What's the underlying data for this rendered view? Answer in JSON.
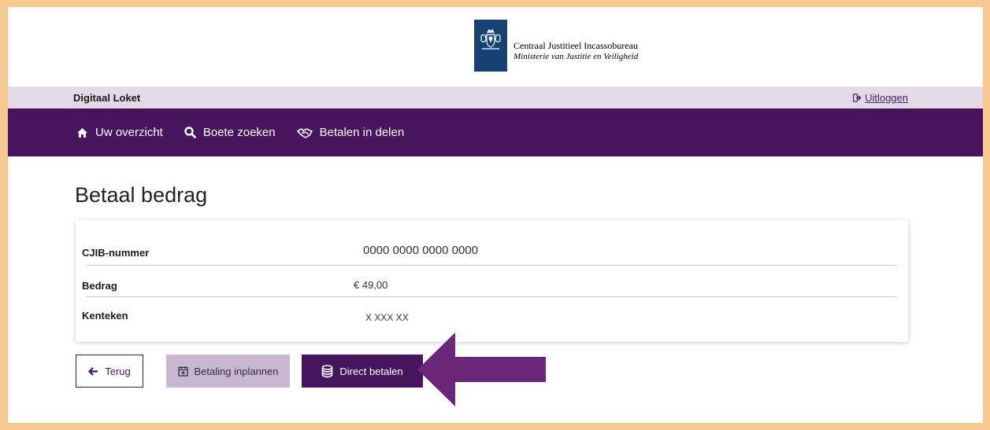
{
  "header": {
    "org_name": "Centraal Justitieel Incassobureau",
    "ministry": "Ministerie van Justitie en Veiligheid",
    "logo_icon": "dutch-coat-of-arms-icon"
  },
  "subbar": {
    "site_name": "Digitaal Loket",
    "logout_label": "Uitloggen",
    "logout_icon": "logout-icon"
  },
  "nav": {
    "items": [
      {
        "label": "Uw overzicht",
        "icon": "home-icon"
      },
      {
        "label": "Boete zoeken",
        "icon": "search-icon"
      },
      {
        "label": "Betalen in delen",
        "icon": "handshake-icon"
      }
    ]
  },
  "page": {
    "title": "Betaal bedrag"
  },
  "details": {
    "rows": [
      {
        "label": "CJIB-nummer",
        "value": "0000 0000 0000 0000"
      },
      {
        "label": "Bedrag",
        "value": "€ 49,00"
      },
      {
        "label": "Kenteken",
        "value": "X XXX XX"
      }
    ]
  },
  "buttons": {
    "back_label": "Terug",
    "plan_label": "Betaling inplannen",
    "pay_label": "Direct betalen"
  },
  "colors": {
    "brand_purple": "#46155d",
    "sub_bar": "#e2dae7",
    "plan_button": "#c8b6d3",
    "logo_blue": "#154273",
    "arrow": "#6a2678",
    "frame": "#f5c890"
  }
}
